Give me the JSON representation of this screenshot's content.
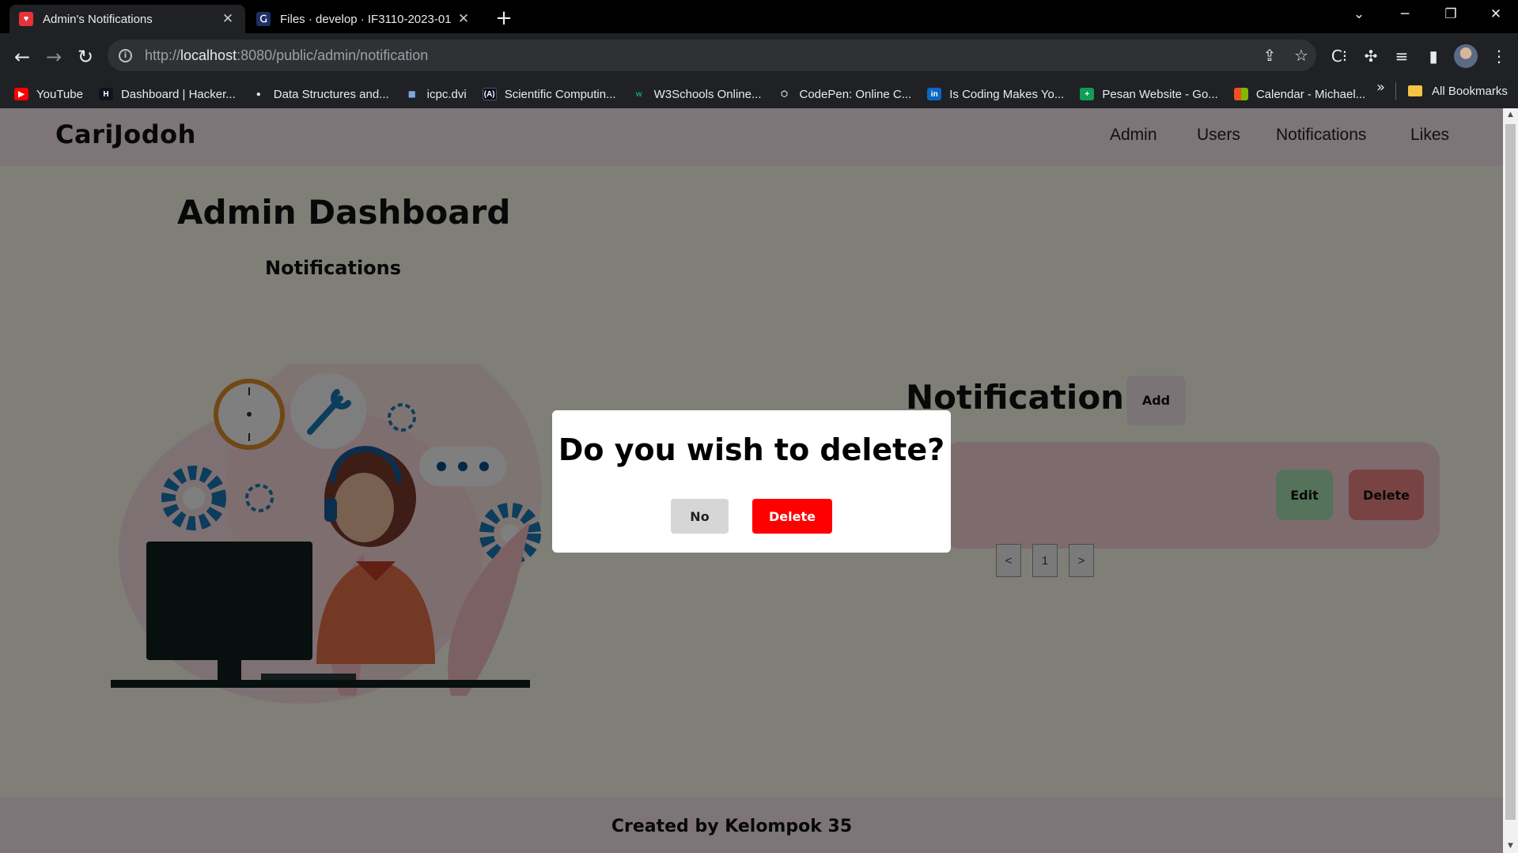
{
  "browser": {
    "tabs": [
      {
        "title": "Admin's Notifications",
        "active": true,
        "favicon": "heart-icon"
      },
      {
        "title": "Files · develop · IF3110-2023-01",
        "active": false,
        "favicon": "gitlab-icon"
      }
    ],
    "url_host": "localhost",
    "url_rest": ":8080/public/admin/notification",
    "url_scheme": "http://",
    "bookmarks": [
      {
        "label": "YouTube",
        "icon": "youtube-icon",
        "color": "#ff0000"
      },
      {
        "label": "Dashboard | Hacker...",
        "icon": "hackerrank-icon",
        "color": "#1ba94c"
      },
      {
        "label": "Data Structures and...",
        "icon": "bulb-icon",
        "color": "#e8eaed"
      },
      {
        "label": "icpc.dvi",
        "icon": "grid-icon",
        "color": "#8ab4f8"
      },
      {
        "label": "Scientific Computin...",
        "icon": "freecodecamp-icon",
        "color": "#0a0a23"
      },
      {
        "label": "W3Schools Online...",
        "icon": "w3schools-icon",
        "color": "#04aa6d"
      },
      {
        "label": "CodePen: Online C...",
        "icon": "codepen-icon",
        "color": "#e8eaed"
      },
      {
        "label": "Is Coding Makes Yo...",
        "icon": "linkedin-icon",
        "color": "#0a66c2"
      },
      {
        "label": "Pesan Website - Go...",
        "icon": "sheets-plus-icon",
        "color": "#0f9d58"
      },
      {
        "label": "Calendar - Michael...",
        "icon": "microsoft-icon",
        "color": "#f25022"
      }
    ],
    "bookmarks_more": "»",
    "all_bookmarks": "All Bookmarks"
  },
  "site": {
    "brand": "CariJodoh",
    "nav": [
      "Admin",
      "Users",
      "Notifications",
      "Likes"
    ],
    "heading": "Admin Dashboard",
    "subheading": "Notifications",
    "section_title": "Notification",
    "add_label": "Add",
    "edit_label": "Edit",
    "delete_label": "Delete",
    "pagination": [
      "<",
      "1",
      ">"
    ],
    "footer": "Created by Kelompok 35",
    "colors": {
      "nav_bg": "#fbeaf0",
      "content_bg": "#fffff0",
      "card_bg": "#fcd7dc",
      "edit_bg": "#a8e6b5",
      "delete_bg": "#f28787"
    }
  },
  "modal": {
    "question": "Do you wish to delete?",
    "no_label": "No",
    "delete_label": "Delete",
    "delete_color": "#ff0000"
  }
}
